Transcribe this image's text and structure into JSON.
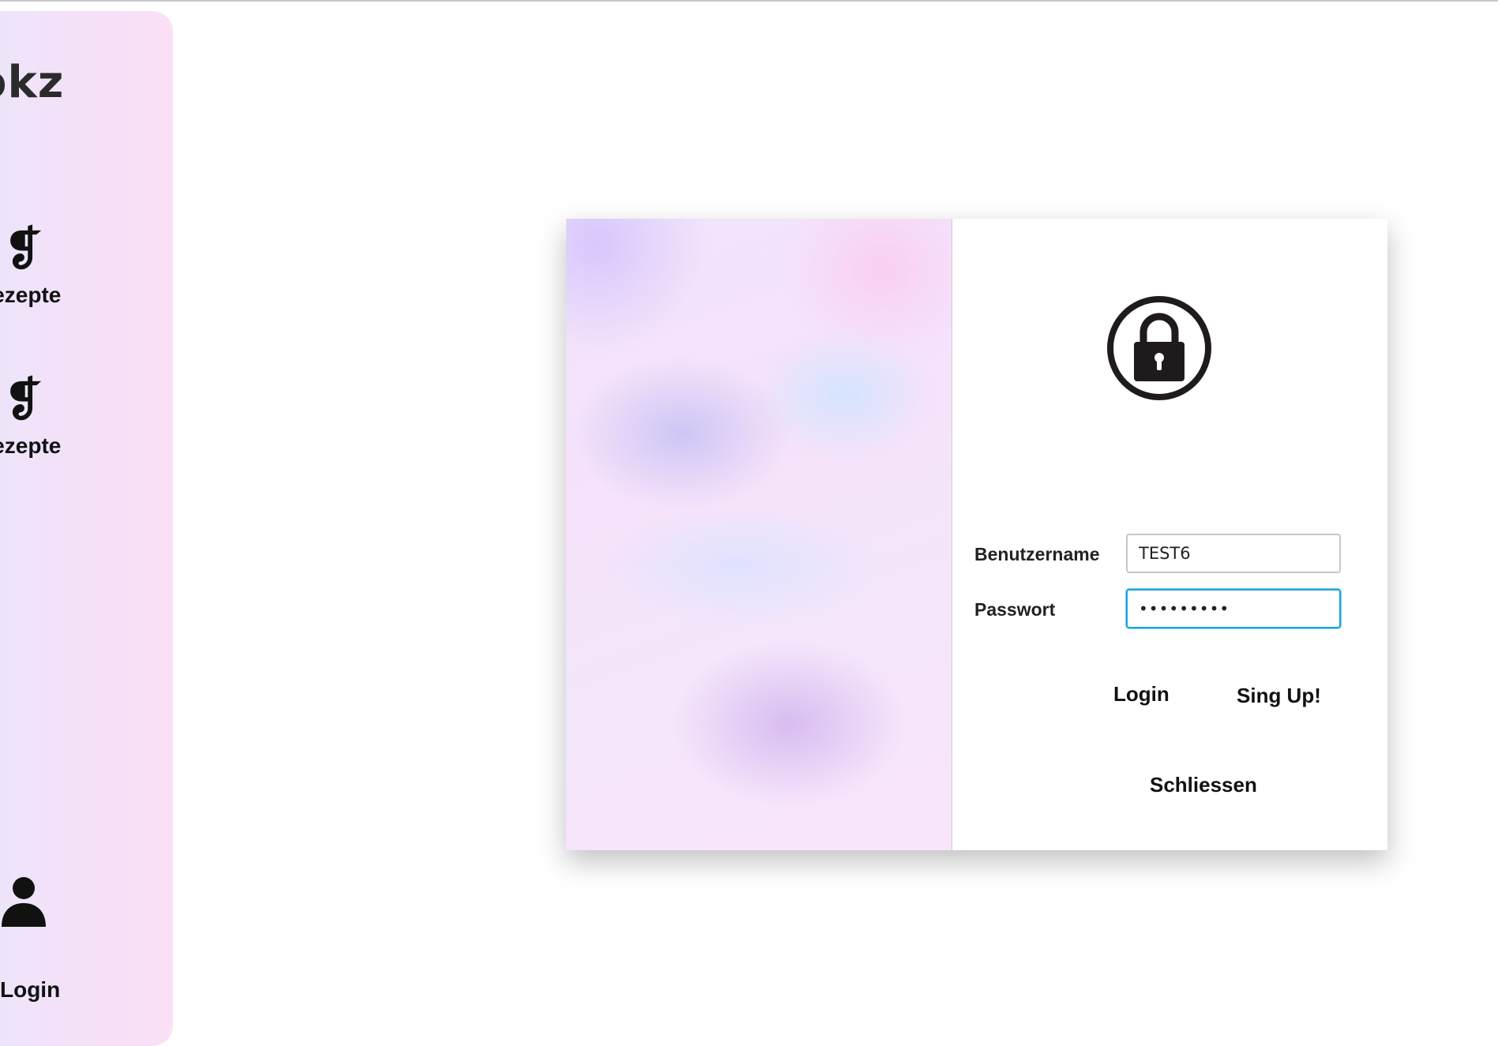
{
  "sidebar": {
    "brand": "okz",
    "nav_items": [
      {
        "icon": "pilcrow-icon",
        "label": "Rezepte"
      },
      {
        "icon": "pilcrow-icon",
        "label": "Rezepte"
      }
    ],
    "login": {
      "icon": "user-icon",
      "label": "Login"
    }
  },
  "dialog": {
    "icon": "lock-icon",
    "username": {
      "label": "Benutzername",
      "value": "TEST6"
    },
    "password": {
      "label": "Passwort",
      "value": "•••••••••"
    },
    "buttons": {
      "login": "Login",
      "signup": "Sing Up!",
      "close": "Schliessen"
    }
  },
  "colors": {
    "sidebar_gradient_start": "#ece6fb",
    "sidebar_gradient_end": "#fbe0f6",
    "focus_border": "#1aa3dd",
    "text": "#111111"
  }
}
